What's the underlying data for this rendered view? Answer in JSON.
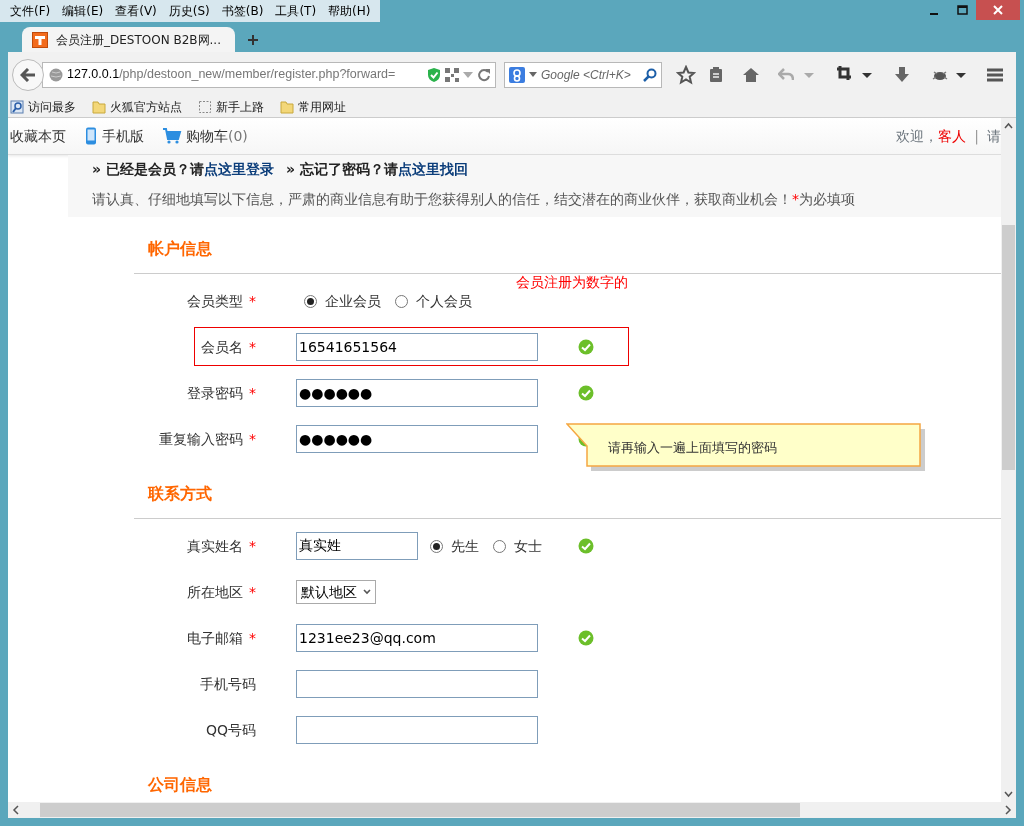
{
  "menu_bar": [
    "文件(F)",
    "编辑(E)",
    "查看(V)",
    "历史(S)",
    "书签(B)",
    "工具(T)",
    "帮助(H)"
  ],
  "tabs": [
    {
      "title": "会员注册_DESTOON B2B网...",
      "selected": true
    }
  ],
  "address_bar": {
    "host": "127.0.0.1",
    "path": "/php/destoon_new/member/register.php?forward="
  },
  "search_box": {
    "placeholder": "Google <Ctrl+K>"
  },
  "bookmarks": [
    {
      "label": "访问最多",
      "kind": "smart"
    },
    {
      "label": "火狐官方站点",
      "kind": "folder"
    },
    {
      "label": "新手上路",
      "kind": "page"
    },
    {
      "label": "常用网址",
      "kind": "folder"
    }
  ],
  "site_bar": {
    "links": [
      {
        "label": "收藏本页",
        "kind": "plain"
      },
      {
        "label": "手机版",
        "kind": "mobile"
      },
      {
        "label": "购物车",
        "count": "(0)",
        "kind": "cart"
      }
    ],
    "greeting": "欢迎，",
    "user": "客人",
    "separator": "|",
    "trailing": "请"
  },
  "notice": {
    "prompts": [
      {
        "prefix": "» 已经是会员？请",
        "link": "点这里登录"
      },
      {
        "prefix": "» 忘记了密码？请",
        "link": "点这里找回"
      }
    ],
    "message": "请认真、仔细地填写以下信息，严肃的商业信息有助于您获得别人的信任，结交潜在的商业伙伴，获取商业机会！",
    "required_mark": "*",
    "required_note": "为必填项"
  },
  "annotation": "会员注册为数字的",
  "sections": [
    {
      "title": "帐户信息",
      "fields": [
        {
          "kind": "radio",
          "label": "会员类型",
          "required_mark": "*",
          "options": [
            {
              "label": "企业会员",
              "selected": true
            },
            {
              "label": "个人会员",
              "selected": false
            }
          ]
        },
        {
          "kind": "text",
          "label": "会员名",
          "required_mark": "*",
          "value": "16541651564",
          "valid": true,
          "highlighted": true
        },
        {
          "kind": "text",
          "label": "登录密码",
          "required_mark": "*",
          "value": "●●●●●●",
          "valid": true
        },
        {
          "kind": "text",
          "label": "重复输入密码",
          "required_mark": "*",
          "value": "●●●●●●",
          "valid": true,
          "tooltip": "请再输入一遍上面填写的密码"
        }
      ]
    },
    {
      "title": "联系方式",
      "fields": [
        {
          "kind": "name",
          "label": "真实姓名",
          "required_mark": "*",
          "value": "真实姓",
          "options": [
            {
              "label": "先生",
              "selected": true
            },
            {
              "label": "女士",
              "selected": false
            }
          ],
          "valid": true
        },
        {
          "kind": "select",
          "label": "所在地区",
          "required_mark": "*",
          "value": "默认地区"
        },
        {
          "kind": "text",
          "label": "电子邮箱",
          "required_mark": "*",
          "value": "1231ee23@qq.com",
          "valid": true
        },
        {
          "kind": "text",
          "label": "手机号码"
        },
        {
          "kind": "text",
          "label": "QQ号码"
        }
      ]
    },
    {
      "title": "公司信息"
    }
  ]
}
